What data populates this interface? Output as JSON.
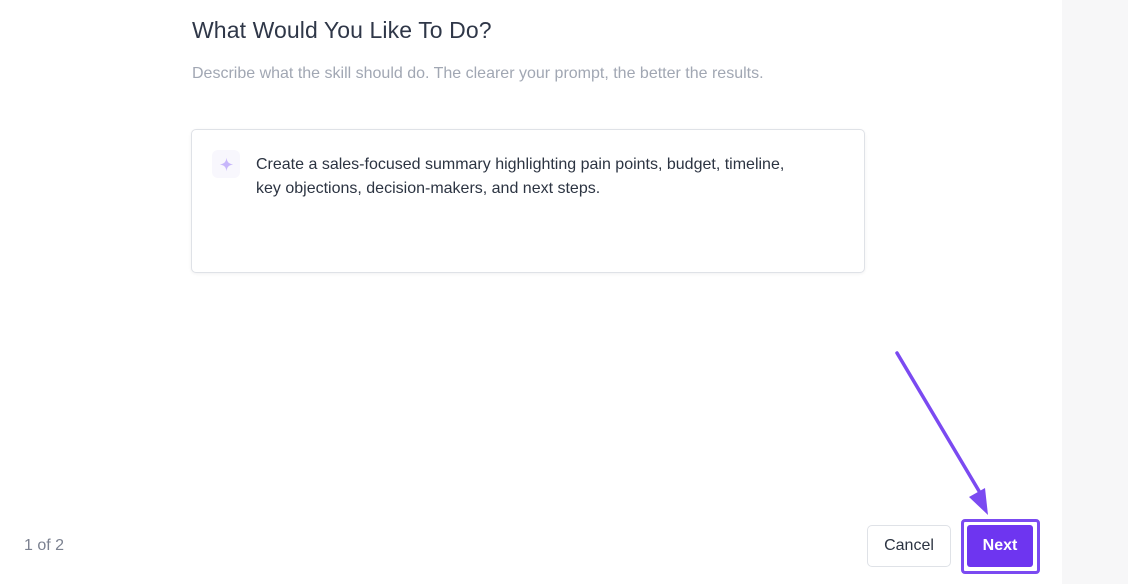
{
  "header": {
    "title": "What Would You Like To Do?",
    "subtitle": "Describe what the skill should do. The clearer your prompt, the better the results."
  },
  "prompt": {
    "icon": "sparkle-icon",
    "text": "Create a sales-focused summary highlighting pain points, budget, timeline,\nkey objections, decision-makers, and next steps."
  },
  "footer": {
    "step": "1 of 2",
    "cancel_label": "Cancel",
    "next_label": "Next"
  },
  "colors": {
    "accent": "#6e35f0",
    "highlight": "#7b4af1",
    "sparkle": "#c7b6fb",
    "title": "#2f3748",
    "subtitle": "#a1a7b3"
  }
}
